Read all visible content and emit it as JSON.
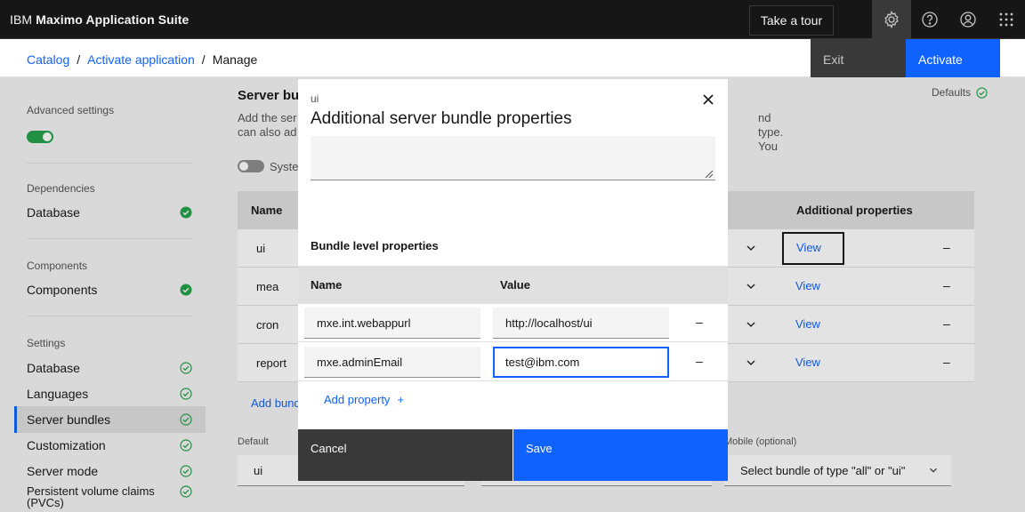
{
  "header": {
    "brand_prefix": "IBM",
    "brand_name": "Maximo Application Suite",
    "tour_label": "Take a tour",
    "icons": [
      "gear-icon",
      "help-icon",
      "user-avatar-icon",
      "app-switcher-icon"
    ]
  },
  "breadcrumb": {
    "items": [
      "Catalog",
      "Activate application"
    ],
    "current": "Manage"
  },
  "actions": {
    "exit": "Exit",
    "activate": "Activate"
  },
  "sidebar": {
    "advanced_settings": "Advanced settings",
    "dependencies_title": "Dependencies",
    "dependencies": [
      {
        "label": "Database"
      }
    ],
    "components_title": "Components",
    "components": [
      {
        "label": "Components"
      }
    ],
    "settings_title": "Settings",
    "settings": [
      {
        "label": "Database"
      },
      {
        "label": "Languages"
      },
      {
        "label": "Server bundles"
      },
      {
        "label": "Customization"
      },
      {
        "label": "Server mode"
      },
      {
        "label": "Persistent volume claims (PVCs)"
      }
    ]
  },
  "main": {
    "title": "Server bun",
    "desc_line1": "Add the ser",
    "desc_line1_tail": "nd type. You",
    "desc_line2": "can also ad",
    "defaults_label": "Defaults",
    "system_toggle_label": "Syste",
    "table": {
      "col_name": "Name",
      "col_additional": "Additional properties",
      "view_label": "View",
      "rows": [
        {
          "name": "ui"
        },
        {
          "name": "mea"
        },
        {
          "name": "cron"
        },
        {
          "name": "report"
        }
      ]
    },
    "add_bundle": "Add bund",
    "default_label": "Default",
    "default_value": "ui",
    "mobile_label": "Mobile (optional)",
    "mobile_placeholder": "Select bundle of type \"all\" or \"ui\""
  },
  "modal": {
    "label": "ui",
    "title": "Additional server bundle properties",
    "textarea_value": "",
    "section_title": "Bundle level properties",
    "col_name": "Name",
    "col_value": "Value",
    "properties": [
      {
        "name": "mxe.int.webappurl",
        "value": "http://localhost/ui"
      },
      {
        "name": "mxe.adminEmail",
        "value": "test@ibm.com"
      }
    ],
    "add_property": "Add property",
    "add_icon": "+",
    "remove_symbol": "–",
    "cancel": "Cancel",
    "save": "Save"
  },
  "colors": {
    "accent": "#0f62fe",
    "success": "#24a148",
    "header_bg": "#161616"
  }
}
